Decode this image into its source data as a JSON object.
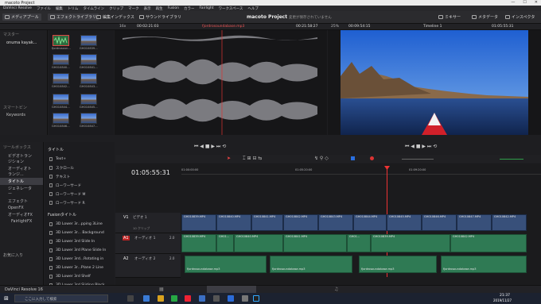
{
  "window": {
    "title": "macoto Project",
    "controls": [
      "—",
      "☐",
      "✕"
    ]
  },
  "menu": [
    "DaVinci Resolve",
    "ファイル",
    "編集",
    "トリム",
    "タイムライン",
    "クリップ",
    "マーク",
    "表示",
    "再生",
    "Fusion",
    "カラー",
    "Fairlight",
    "ワークスペース",
    "ヘルプ"
  ],
  "toolbar": {
    "media_pool": "メディアプール",
    "effects_library": "エフェクトライブラリ",
    "edit_index": "編集インデックス",
    "sound_library": "サウンドライブラリ",
    "project_name": "macoto Project",
    "project_status": "変更が保存されていません",
    "mixer": "ミキサー",
    "metadata": "メタデータ",
    "inspector": "インスペクタ"
  },
  "source_viewer": {
    "zoom": "16x",
    "timecode": "00:02:21:03",
    "clip_name": "fjordrosoundabase.mp3",
    "duration": "00:21:58:27"
  },
  "timeline_viewer": {
    "zoom": "25%",
    "timecode": "00:09:54:15",
    "timeline_name": "Timeline 1",
    "current_tc": "01:05:55:31"
  },
  "left_pane": {
    "master": "マスター",
    "bin_item": "onuma kayak...",
    "smart_bins": "スマートビン",
    "keywords": "Keywords"
  },
  "media_pool": {
    "items": [
      {
        "name": "fjordrosoun...",
        "kind": "audio"
      },
      {
        "name": "GH010839...",
        "kind": "video"
      },
      {
        "name": "GH010840...",
        "kind": "video"
      },
      {
        "name": "GH010841...",
        "kind": "video"
      },
      {
        "name": "GH010842...",
        "kind": "video"
      },
      {
        "name": "GH010843...",
        "kind": "video"
      },
      {
        "name": "GH010844...",
        "kind": "video"
      },
      {
        "name": "GH010845...",
        "kind": "video"
      },
      {
        "name": "GH010846...",
        "kind": "video"
      },
      {
        "name": "GH010847...",
        "kind": "video"
      }
    ]
  },
  "fx_tree": {
    "toolbox": "ツールボックス",
    "items": [
      "ビデオトランジション",
      "オーディオトランジ...",
      "タイトル",
      "ジェネレーター",
      "エフェクト",
      "OpenFX",
      "オーディオFX",
      "FairlightFX"
    ],
    "favorites": "お気に入り"
  },
  "fx_list": {
    "title_header": "タイトル",
    "titles": [
      "Text+",
      "スクロール",
      "テキスト",
      "ローワーサード",
      "ローワーサード M",
      "ローワーサード R"
    ],
    "fusion_header": "Fusionタイトル",
    "fusion_titles": [
      "3D Lower 3r...pping 3Line",
      "3D Lower 3r... Background",
      "3D Lower 3rd Slide In",
      "3D Lower 3rd Plane Slide In",
      "3D Lower 3rd...Rotating in",
      "3D Lower 3r...Plane 2 Line",
      "3D Lower 3rd Shelf",
      "3D Lower 3rd Sliding Block"
    ]
  },
  "timeline": {
    "timecode": "01:05:55:31",
    "ruler": [
      "01:00:00:00",
      "01:05:20:00",
      "01:09:20:00"
    ],
    "tracks": [
      {
        "id": "V1",
        "name": "ビデオ 1",
        "clips": "10 クリップ"
      },
      {
        "id": "A1",
        "name": "オーディオ 1",
        "level": "2.0"
      },
      {
        "id": "A2",
        "name": "オーディオ 2",
        "level": "2.0"
      }
    ],
    "video_clips": [
      "GH010839.MP4",
      "GH010840.MP4",
      "GH010841.MP4",
      "GH010842.MP4",
      "GH010843.MP4",
      "GH010844.MP4",
      "GH010845.MP4",
      "GH010846.MP4",
      "GH010847.MP4",
      "GH010842.MP4"
    ],
    "a1_clips": [
      "GH010839.MP4",
      "GH01...",
      "GH010840.MP4",
      "GH010841.MP4",
      "GH01...",
      "GH010839.MP4",
      "GH010842.MP4"
    ],
    "a2_clips": [
      "fjordrosoundabase.mp3",
      "fjordrosoundabase.mp3",
      "fjordrosoundabase.mp3",
      "fjordrosoundabase.mp3"
    ]
  },
  "statusbar": {
    "app": "DaVinci Resolve 16"
  },
  "taskbar": {
    "search_placeholder": "ここに入力して検索",
    "time": "21:37",
    "date": "2019/11/27"
  },
  "colors": {
    "accent": "#d33",
    "video_clip": "#38507a",
    "audio_clip": "#2f7a54"
  }
}
